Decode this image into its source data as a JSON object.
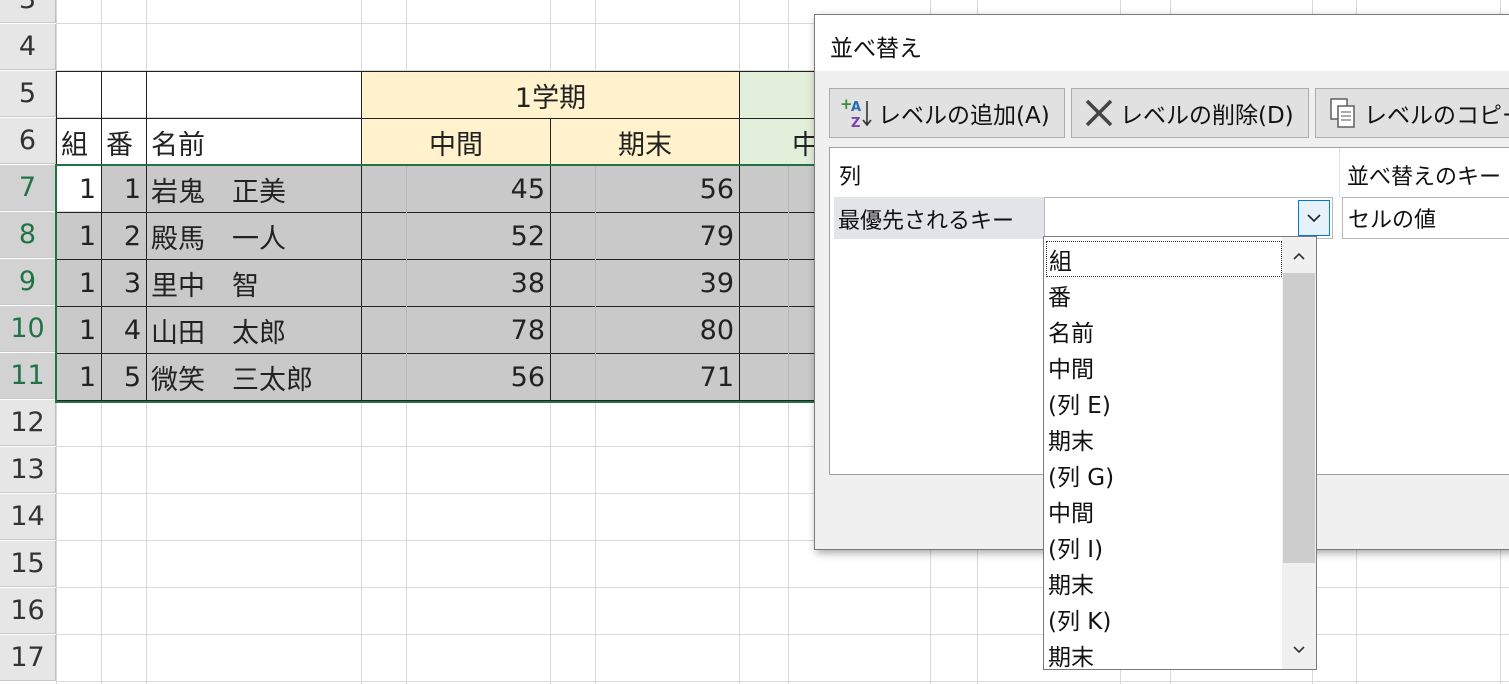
{
  "spreadsheet": {
    "row_numbers": [
      "3",
      "4",
      "5",
      "6",
      "7",
      "8",
      "9",
      "10",
      "11",
      "12",
      "13",
      "14",
      "15",
      "16",
      "17"
    ],
    "selected_rows": [
      "7",
      "8",
      "9",
      "10",
      "11"
    ],
    "headers": {
      "kumi": "組",
      "ban": "番",
      "namae": "名前",
      "term1": "1学期",
      "chukan": "中間",
      "kimatsu": "期末",
      "partial_next": "中"
    },
    "rows": [
      {
        "kumi": "1",
        "ban": "1",
        "name": "岩鬼　正美",
        "chukan": "45",
        "kimatsu": "56"
      },
      {
        "kumi": "1",
        "ban": "2",
        "name": "殿馬　一人",
        "chukan": "52",
        "kimatsu": "79"
      },
      {
        "kumi": "1",
        "ban": "3",
        "name": "里中　智",
        "chukan": "38",
        "kimatsu": "39"
      },
      {
        "kumi": "1",
        "ban": "4",
        "name": "山田　太郎",
        "chukan": "78",
        "kimatsu": "80"
      },
      {
        "kumi": "1",
        "ban": "5",
        "name": "微笑　三太郎",
        "chukan": "56",
        "kimatsu": "71"
      }
    ]
  },
  "dialog": {
    "title": "並べ替え",
    "buttons": {
      "add_level": "レベルの追加(A)",
      "delete_level": "レベルの削除(D)",
      "copy_level": "レベルのコピー("
    },
    "columns": {
      "column_header": "列",
      "sort_on_header": "並べ替えのキー"
    },
    "level": {
      "label": "最優先されるキー",
      "column_value": "",
      "sort_on_value": "セルの値"
    },
    "dropdown_options": [
      "組",
      "番",
      "名前",
      "中間",
      "(列 E)",
      "期末",
      "(列 G)",
      "中間",
      "(列 I)",
      "期末",
      "(列 K)",
      "期末"
    ],
    "focused_option": "組"
  },
  "colors": {
    "selection_green": "#217346",
    "term_yellow": "#fff2cc",
    "term_green": "#e2efda",
    "selected_fill": "#c9c9c9"
  },
  "icons": [
    "add-level-icon",
    "delete-level-icon",
    "copy-level-icon",
    "chevron-down-icon",
    "chevron-up-icon"
  ]
}
